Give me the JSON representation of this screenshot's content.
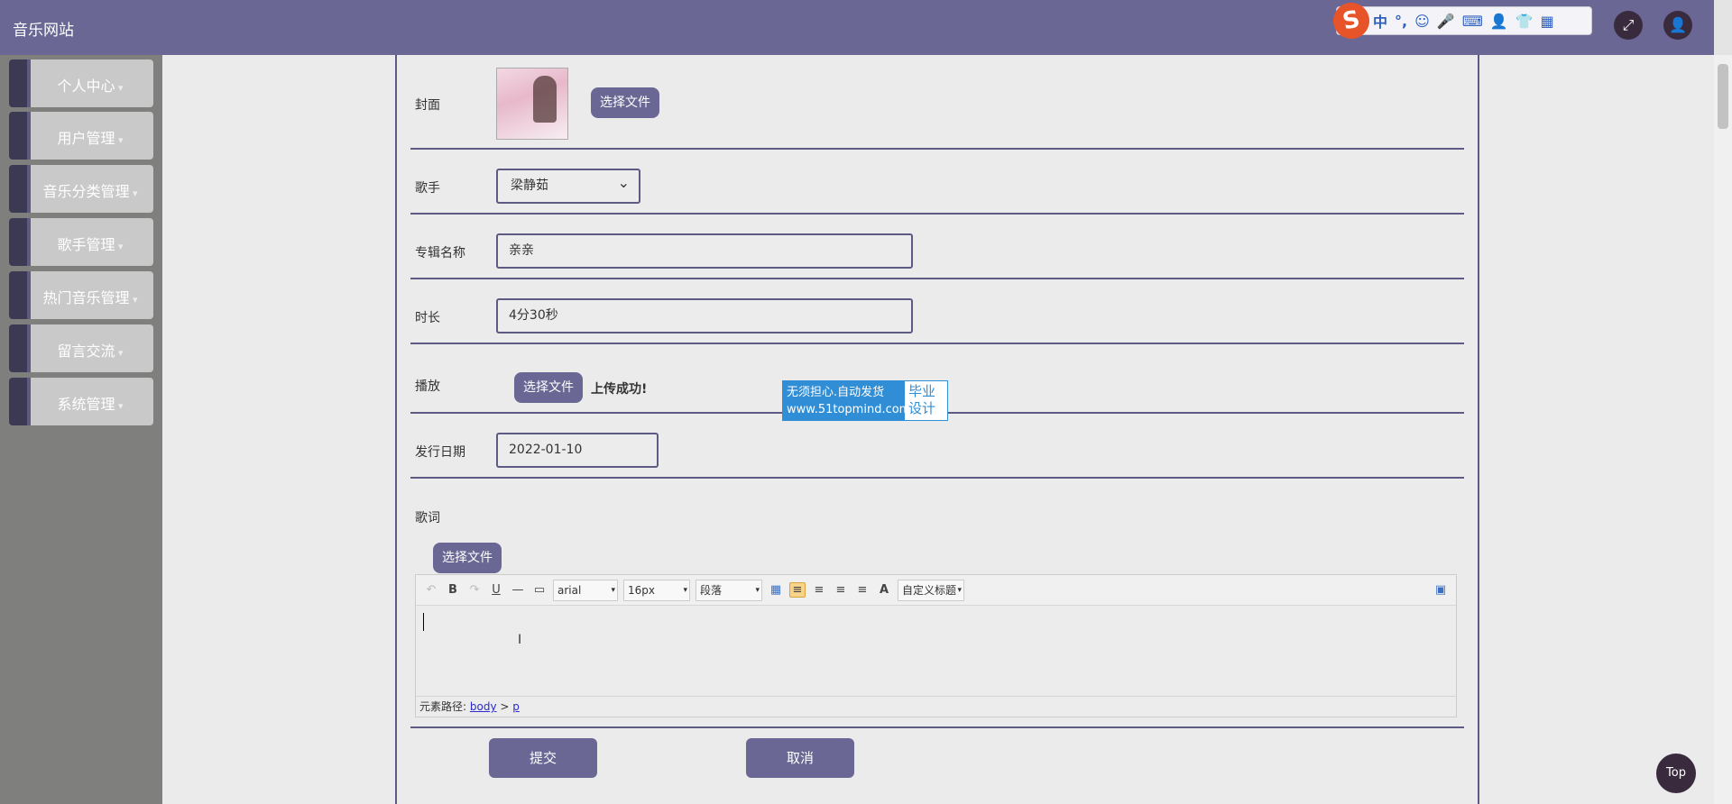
{
  "header": {
    "site_title": "音乐网站",
    "ime": {
      "logo": "S",
      "items": [
        "中",
        "°,",
        "☺",
        "🎤",
        "⌨",
        "👤",
        "👕",
        "▦"
      ]
    },
    "fullscreen_icon": "⤢",
    "user_icon": "👤"
  },
  "sidebar": {
    "items": [
      {
        "label": "个人中心"
      },
      {
        "label": "用户管理"
      },
      {
        "label": "音乐分类管理"
      },
      {
        "label": "歌手管理"
      },
      {
        "label": "热门音乐管理"
      },
      {
        "label": "留言交流"
      },
      {
        "label": "系统管理"
      }
    ]
  },
  "form": {
    "cover": {
      "label": "封面",
      "button": "选择文件"
    },
    "singer": {
      "label": "歌手",
      "value": "梁静茹"
    },
    "album": {
      "label": "专辑名称",
      "value": "亲亲"
    },
    "duration": {
      "label": "时长",
      "value": "4分30秒"
    },
    "play": {
      "label": "播放",
      "button": "选择文件",
      "status": "上传成功!"
    },
    "release_date": {
      "label": "发行日期",
      "value": "2022-01-10"
    },
    "lyrics": {
      "label": "歌词",
      "button": "选择文件"
    }
  },
  "watermark": {
    "line1": "无须担心.自动发货",
    "line2": "www.51topmind.com",
    "side1": "毕业",
    "side2": "设计"
  },
  "editor": {
    "toolbar": {
      "undo": "↶",
      "bold": "B",
      "redo": "↷",
      "underline": "U",
      "hr": "—",
      "paste": "▭",
      "font": "arial",
      "size": "16px",
      "paragraph": "段落",
      "table": "▦",
      "align_left": "≡",
      "align_right": "≡",
      "align_center": "≡",
      "justify": "≡",
      "font_color": "A",
      "custom_title": "自定义标题",
      "fullscreen": "▣"
    },
    "ibeam": "I",
    "path_label": "元素路径:",
    "path_body": "body",
    "path_sep": ">",
    "path_p": "p"
  },
  "actions": {
    "submit": "提交",
    "cancel": "取消"
  },
  "top_button": "Top"
}
